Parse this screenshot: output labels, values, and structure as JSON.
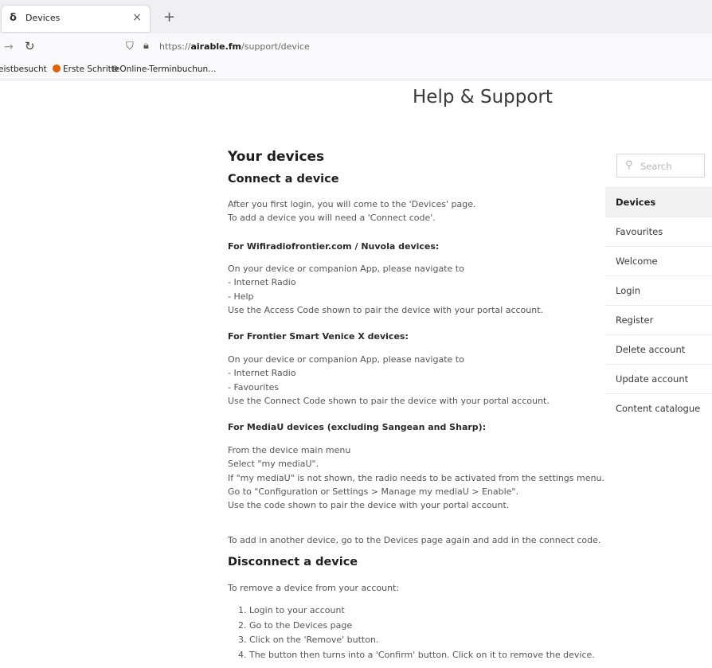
{
  "browser": {
    "tab_title": "Devices",
    "tab_favicon": "δ",
    "tab_close": "×",
    "new_tab": "+",
    "url_scheme": "https://",
    "url_host": "airable.fm",
    "url_path": "/support/device",
    "bookmarks": [
      "eistbesucht",
      "Erste Schritte",
      "Online-Terminbuchun..."
    ]
  },
  "header": {
    "title": "Help & Support"
  },
  "main": {
    "page_title": "Your devices",
    "connect_title": "Connect a device",
    "intro_lines": [
      "After you first login, you will come to the 'Devices' page.",
      "To add a device you will need a 'Connect code'."
    ],
    "wifi_title": "For Wifiradiofrontier.com / Nuvola devices:",
    "wifi_lines": [
      "On your device or companion App, please navigate to",
      "- Internet Radio",
      "- Help",
      "Use the Access Code shown to pair the device with your portal account."
    ],
    "venice_title": "For Frontier Smart Venice X devices:",
    "venice_lines": [
      "On your device or companion App, please navigate to",
      "- Internet Radio",
      "- Favourites",
      "Use the Connect Code shown to pair the device with your portal account."
    ],
    "mediau_title": "For MediaU devices (excluding Sangean and Sharp):",
    "mediau_lines": [
      "From the device main menu",
      "Select \"my mediaU\".",
      "If \"my mediaU\" is not shown, the radio needs to be activated from the settings menu.",
      "Go to \"Configuration or Settings > Manage my mediaU > Enable\".",
      "Use the code shown to pair the device with your portal account."
    ],
    "another_device": "To add in another device, go to the Devices page again and add in the connect code.",
    "disconnect_title": "Disconnect a device",
    "disconnect_intro": "To remove a device from your account:",
    "disconnect_steps": [
      "1. Login to your account",
      "2. Go to the Devices page",
      "3. Click on the 'Remove' button.",
      "4. The button then turns into a 'Confirm' button. Click on it to remove the device."
    ]
  },
  "sidebar": {
    "search_placeholder": "Search",
    "items": [
      "Devices",
      "Favourites",
      "Welcome",
      "Login",
      "Register",
      "Delete account",
      "Update account",
      "Content catalogue"
    ],
    "active_index": 0
  }
}
